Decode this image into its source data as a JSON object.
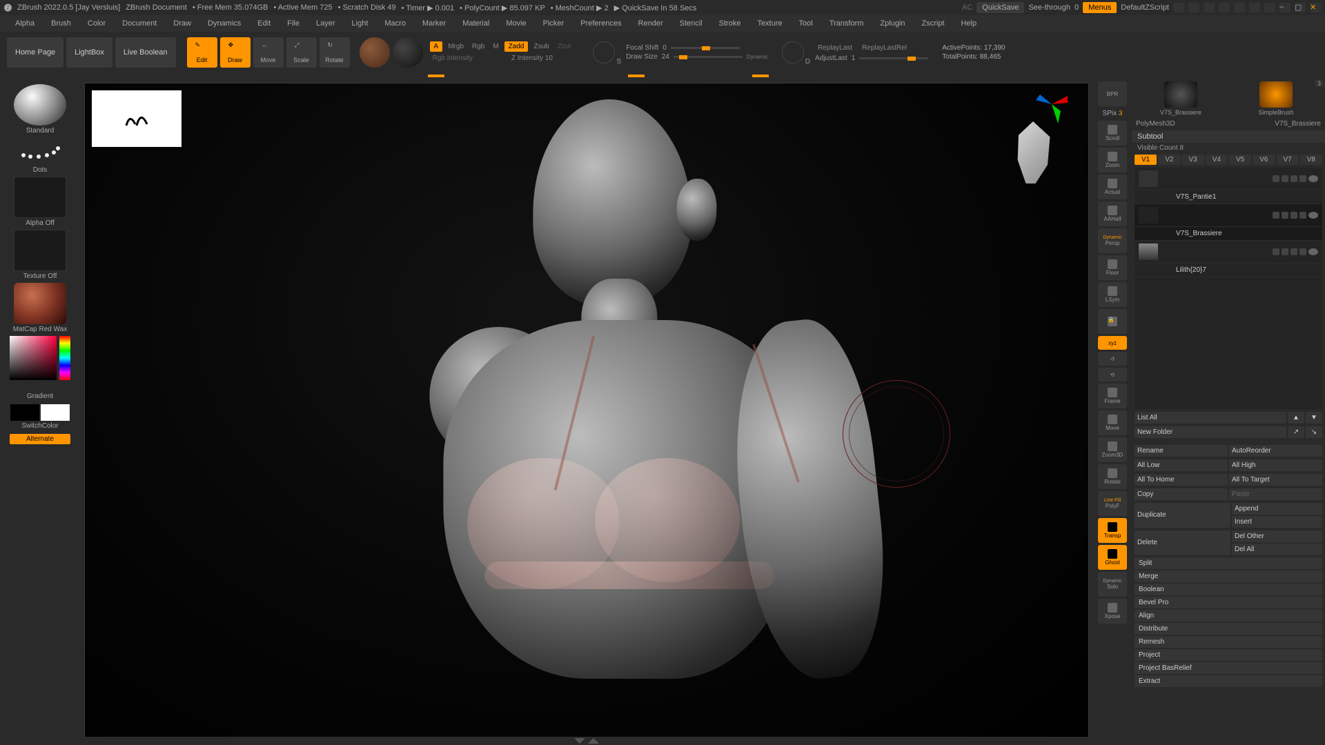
{
  "title_bar": {
    "app": "ZBrush 2022.0.5 [Jay Versluis]",
    "doc": "ZBrush Document",
    "free_mem": "Free Mem 35.074GB",
    "active_mem": "Active Mem 725",
    "scratch": "Scratch Disk 49",
    "timer": "Timer ▶ 0.001",
    "polycount": "PolyCount ▶ 85.097 KP",
    "meshcount": "MeshCount ▶ 2",
    "quicksave": "QuickSave In 58 Secs",
    "ac": "AC",
    "quicksave_btn": "QuickSave",
    "seethrough": "See-through",
    "seethrough_val": "0",
    "menus": "Menus",
    "default_zscript": "DefaultZScript"
  },
  "menu": [
    "Alpha",
    "Brush",
    "Color",
    "Document",
    "Draw",
    "Dynamics",
    "Edit",
    "File",
    "Layer",
    "Light",
    "Macro",
    "Marker",
    "Material",
    "Movie",
    "Picker",
    "Preferences",
    "Render",
    "Stencil",
    "Stroke",
    "Texture",
    "Tool",
    "Transform",
    "Zplugin",
    "Zscript",
    "Help"
  ],
  "shelf": {
    "home": "Home Page",
    "lightbox": "LightBox",
    "live_boolean": "Live Boolean",
    "edit": "Edit",
    "draw": "Draw",
    "move": "Move",
    "scale": "Scale",
    "rotate": "Rotate",
    "a_btn": "A",
    "mrgb": "Mrgb",
    "rgb": "Rgb",
    "m": "M",
    "zadd": "Zadd",
    "zsub": "Zsub",
    "zcut": "Zcut",
    "rgb_intensity": "Rgb Intensity",
    "z_intensity": "Z Intensity",
    "z_intensity_val": "10",
    "focal_shift": "Focal Shift",
    "focal_shift_val": "0",
    "draw_size": "Draw Size",
    "draw_size_val": "24",
    "dynamic": "Dynamic",
    "s_curve": "S",
    "d_curve": "D",
    "replay_last": "ReplayLast",
    "replay_last_rel": "ReplayLastRel",
    "adjust_last": "AdjustLast",
    "adjust_last_val": "1",
    "active_points": "ActivePoints:",
    "active_points_val": "17,390",
    "total_points": "TotalPoints:",
    "total_points_val": "88,465"
  },
  "left": {
    "brush": "Standard",
    "stroke": "Dots",
    "alpha": "Alpha Off",
    "texture": "Texture Off",
    "material": "MatCap Red Wax",
    "gradient": "Gradient",
    "switch_color": "SwitchColor",
    "alternate": "Alternate"
  },
  "right_toolbar": {
    "bpr": "BPR",
    "spix": "SPix",
    "spix_val": "3",
    "items": [
      "Scroll",
      "Zoom",
      "Actual",
      "AAHalf",
      "Persp",
      "Floor",
      "LSym",
      "Lock",
      "xyz",
      "",
      "",
      "Frame",
      "Move",
      "Zoom3D",
      "Rotate",
      "PolyF",
      "Transp",
      "Ghost",
      "Solo",
      "Xpose"
    ],
    "dynamic_persp": "Dynamic",
    "line_fill": "Line Fill",
    "dynamic_solo": "Dynamic"
  },
  "right_panel": {
    "top_items": [
      {
        "label": "V7S_Brassiere"
      },
      {
        "label": "SimpleBrush"
      }
    ],
    "sub_labels": [
      "PolyMesh3D",
      "V7S_Brassiere"
    ],
    "count_badge": "3",
    "subtool": "Subtool",
    "visible_count": "Visible Count",
    "visible_count_val": "8",
    "vtabs": [
      "V1",
      "V2",
      "V3",
      "V4",
      "V5",
      "V6",
      "V7",
      "V8"
    ],
    "subtools": [
      {
        "name": "V7S_Pantie1"
      },
      {
        "name": "V7S_Brassiere"
      },
      {
        "name": "Lilith{20}7"
      }
    ],
    "list_all": "List All",
    "new_folder": "New Folder",
    "buttons": {
      "rename": "Rename",
      "autoreorder": "AutoReorder",
      "all_low": "All Low",
      "all_high": "All High",
      "all_to_home": "All To Home",
      "all_to_target": "All To Target",
      "copy": "Copy",
      "paste": "Paste",
      "duplicate": "Duplicate",
      "append": "Append",
      "insert": "Insert",
      "delete": "Delete",
      "del_other": "Del Other",
      "del_all": "Del All",
      "split": "Split",
      "merge": "Merge",
      "boolean": "Boolean",
      "bevel_pro": "Bevel Pro",
      "align": "Align",
      "distribute": "Distribute",
      "remesh": "Remesh",
      "project": "Project",
      "project_bas": "Project BasRelief",
      "extract": "Extract"
    }
  }
}
